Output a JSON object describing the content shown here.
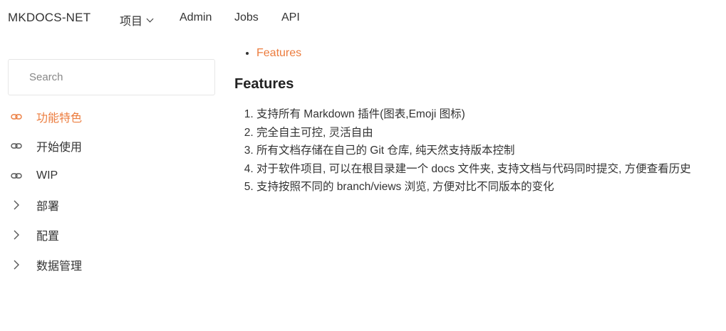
{
  "navbar": {
    "brand": "MKDOCS-NET",
    "items": [
      {
        "label": "项目",
        "dropdown": true
      },
      {
        "label": "Admin"
      },
      {
        "label": "Jobs"
      },
      {
        "label": "API"
      }
    ]
  },
  "sidebar": {
    "search_placeholder": "Search",
    "items": [
      {
        "label": "功能特色",
        "icon": "link-icon",
        "active": true
      },
      {
        "label": "开始使用",
        "icon": "link-icon"
      },
      {
        "label": "WIP",
        "icon": "link-icon"
      },
      {
        "label": "部署",
        "icon": "chevron-right-icon"
      },
      {
        "label": "配置",
        "icon": "chevron-right-icon"
      },
      {
        "label": "数据管理",
        "icon": "chevron-right-icon"
      }
    ]
  },
  "content": {
    "toc": [
      "Features"
    ],
    "heading": "Features",
    "features": [
      "支持所有 Markdown 插件(图表,Emoji 图标)",
      "完全自主可控, 灵活自由",
      "所有文档存储在自己的 Git 仓库, 纯天然支持版本控制",
      "对于软件项目, 可以在根目录建一个 docs 文件夹, 支持文档与代码同时提交, 方便查看历史",
      "支持按照不同的 branch/views 浏览, 方便对比不同版本的变化"
    ]
  },
  "colors": {
    "accent": "#ec7c3e",
    "text": "#333333"
  }
}
